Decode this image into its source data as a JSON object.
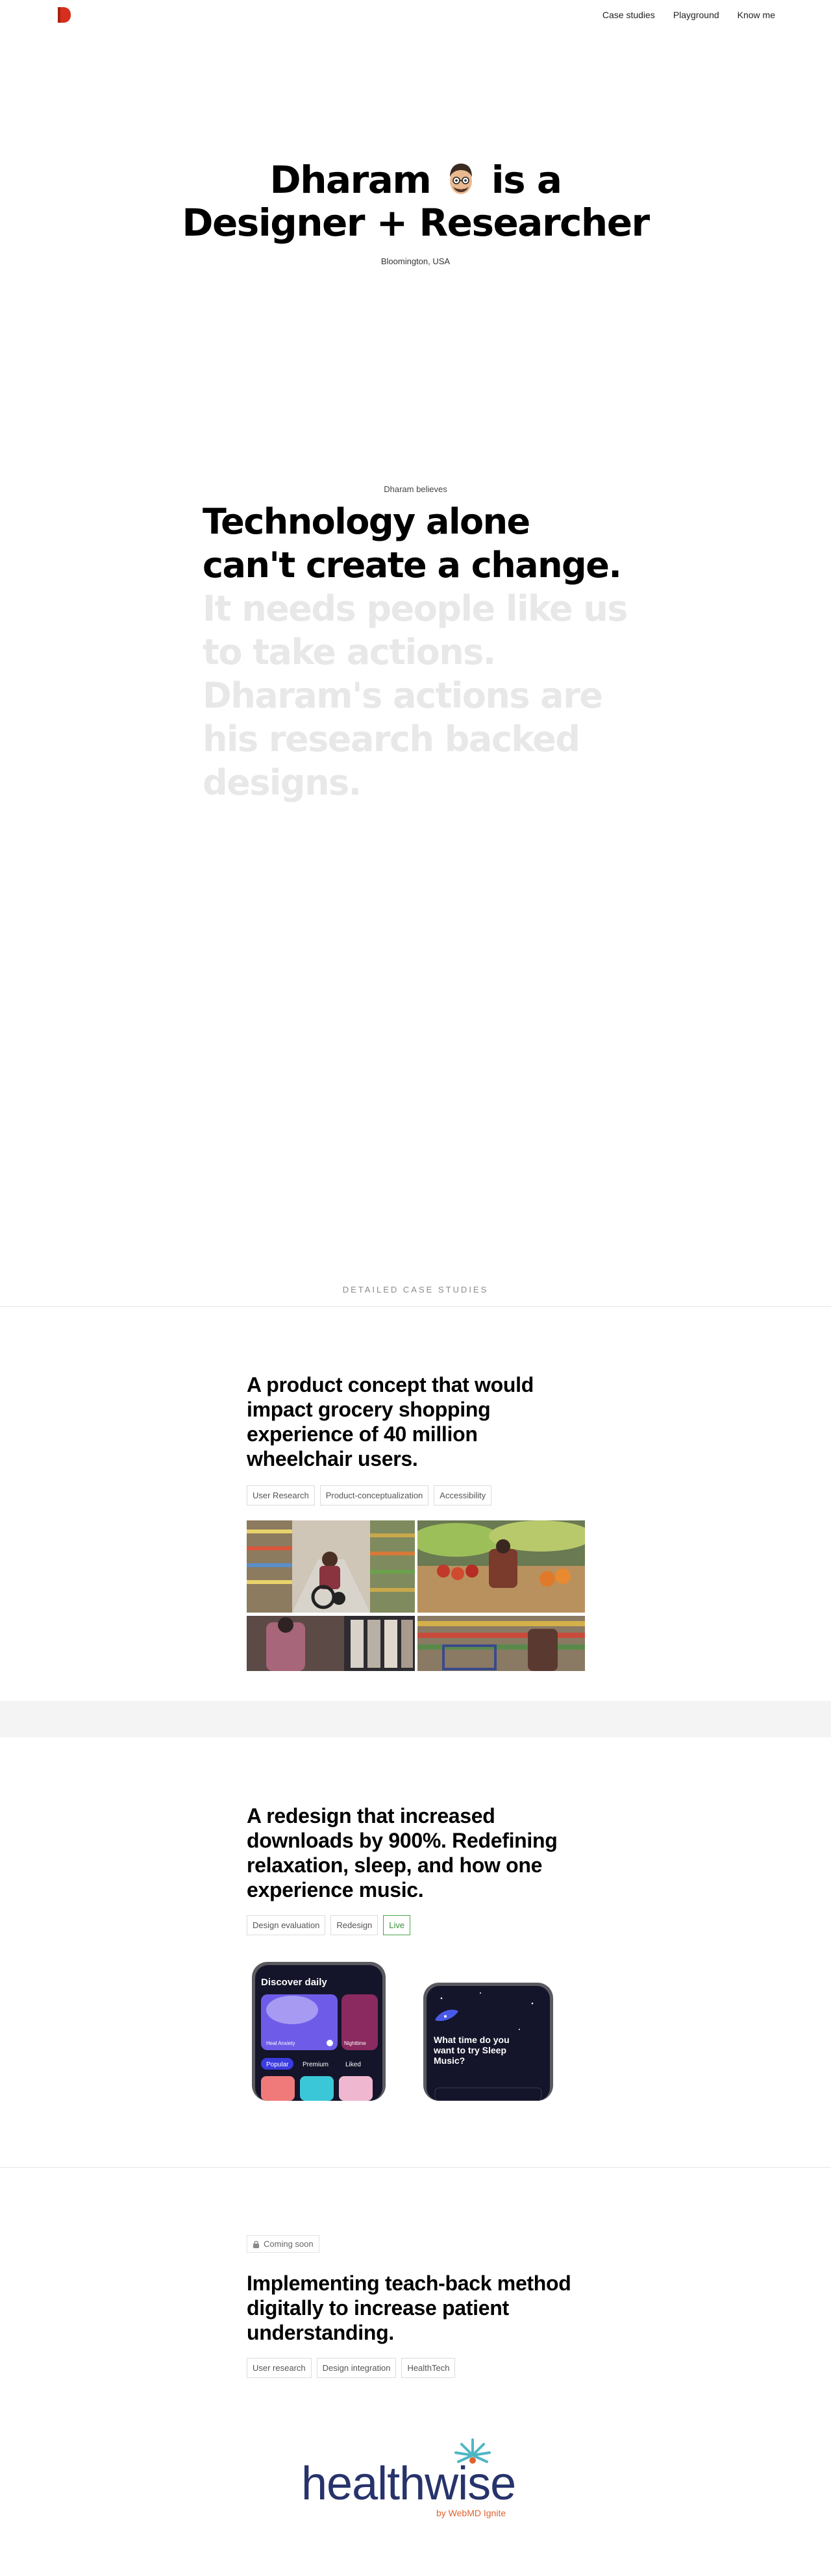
{
  "nav": {
    "logo_letter": "D",
    "links": [
      "Case studies",
      "Playground",
      "Know me"
    ]
  },
  "hero": {
    "line1_a": "Dharam",
    "line1_b": "is a",
    "line2": "Designer + Researcher",
    "location": "Bloomington, USA"
  },
  "belief": {
    "label": "Dharam believes",
    "strong": "Technology alone can't create a change.",
    "faded": "It needs people like us to take actions. Dharam's actions are his research backed designs."
  },
  "section": {
    "label": "DETAILED CASE STUDIES"
  },
  "cases": [
    {
      "title": "A product concept that would impact grocery shopping experience of 40 million wheelchair users.",
      "tags": [
        "User Research",
        "Product-conceptualization",
        "Accessibility"
      ]
    },
    {
      "title": "A redesign that increased downloads by 900%. Redefining relaxation, sleep, and how one experience music.",
      "tags": [
        "Design evaluation",
        "Redesign",
        "Live"
      ],
      "phone_left": {
        "heading": "Discover daily",
        "card_a": "Heal Anxiety",
        "card_b": "Nighttime",
        "tabs": [
          "Popular",
          "Premium",
          "Liked"
        ]
      },
      "phone_right": {
        "question": "What time do you want to try Sleep Music?"
      }
    },
    {
      "status": "Coming soon",
      "title": "Implementing teach-back method digitally to increase patient understanding.",
      "tags": [
        "User research",
        "Design integration",
        "HealthTech"
      ],
      "logo_word": "healthwise",
      "logo_sub": "by WebMD Ignite"
    }
  ],
  "colors": {
    "accent_red": "#d62e1f",
    "faded_text": "#e8e8e8",
    "live_green": "#3c8f3c",
    "healthwise_navy": "#27336b",
    "healthwise_teal": "#4fb6c4",
    "healthwise_orange": "#e0622f"
  }
}
